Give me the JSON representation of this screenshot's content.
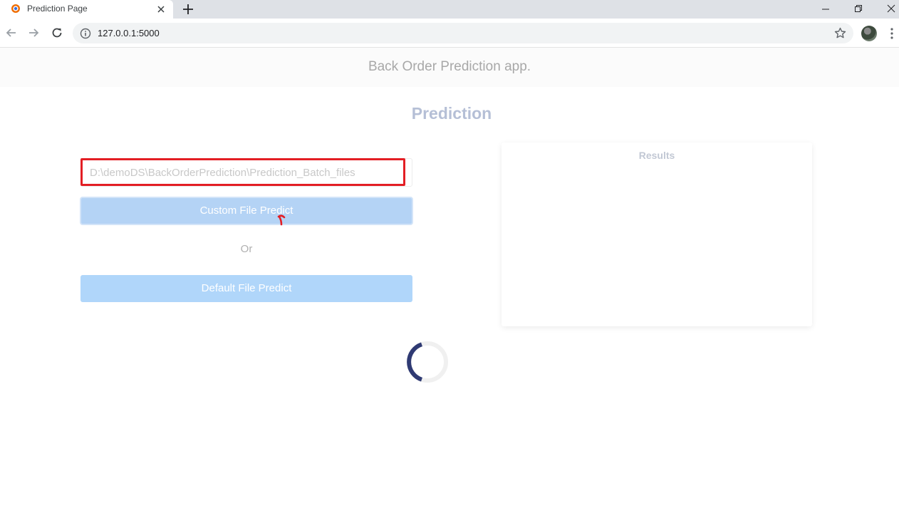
{
  "browser": {
    "tab_title": "Prediction Page",
    "url": "127.0.0.1:5000"
  },
  "app": {
    "header_title": "Back Order Prediction app.",
    "page_title": "Prediction",
    "path_input_value": "D:\\demoDS\\BackOrderPrediction\\Prediction_Batch_files",
    "custom_button_label": "Custom File Predict",
    "or_label": "Or",
    "default_button_label": "Default File Predict",
    "results_title": "Results"
  },
  "icons": {
    "favicon": "app-logo-icon",
    "tab_close": "close-icon",
    "new_tab": "plus-icon",
    "back": "arrow-left-icon",
    "forward": "arrow-right-icon",
    "reload": "reload-icon",
    "site_info": "info-icon",
    "bookmark": "star-icon",
    "menu": "kebab-menu-icon",
    "loading": "spinner-icon"
  },
  "colors": {
    "annotation": "#e31e24",
    "custom_button": "#b4d3f5",
    "default_button": "#b0d6fa",
    "spinner_arc": "#2f3a73"
  }
}
